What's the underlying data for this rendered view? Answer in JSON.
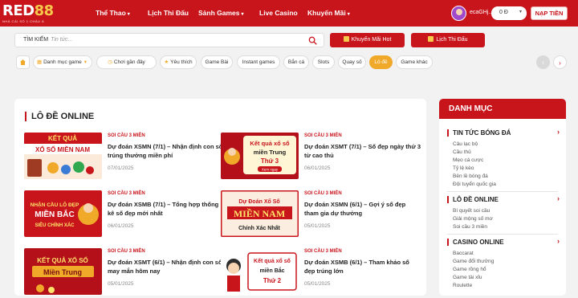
{
  "logo": {
    "brand_main": "RED",
    "brand_num": "88",
    "tagline": "NHÀ CÁI SỐ 1 CHÂU Á"
  },
  "nav": {
    "items": [
      {
        "label": "Thể Thao",
        "caret": "▾"
      },
      {
        "label": "Lịch Thi Đấu",
        "caret": ""
      },
      {
        "label": "Sảnh Games",
        "caret": "▾"
      },
      {
        "label": "Live Casino",
        "caret": ""
      },
      {
        "label": "Khuyến Mãi",
        "caret": "▾"
      }
    ]
  },
  "user": {
    "name": "ecaGHj...",
    "balance": "0 Đ",
    "deposit_label": "NẠP TIỀN"
  },
  "search": {
    "label": "TÌM KIẾM",
    "placeholder": "Tin tức..."
  },
  "hero_buttons": {
    "promo": "Khuyến Mãi Hot",
    "schedule": "Lịch Thi Đấu"
  },
  "filters": [
    {
      "label": "Danh mục game",
      "icon": "grid-icon",
      "active": false
    },
    {
      "label": "Chơi gần đây",
      "icon": "clock-icon",
      "active": false
    },
    {
      "label": "Yêu thích",
      "icon": "star-icon",
      "active": false
    },
    {
      "label": "Game Bài",
      "active": false
    },
    {
      "label": "Instant games",
      "active": false
    },
    {
      "label": "Bắn cá",
      "active": false
    },
    {
      "label": "Slots",
      "active": false
    },
    {
      "label": "Quay số",
      "active": false
    },
    {
      "label": "Lô đề",
      "active": true
    },
    {
      "label": "Game khác",
      "active": false
    }
  ],
  "colors": {
    "brand_red": "#c8141b",
    "accent_orange": "#f0a929"
  },
  "main": {
    "title": "LÔ ĐỀ ONLINE",
    "articles": [
      {
        "category": "SOI CẦU 3 MIỀN",
        "title": "Dự đoán XSMN (7/1) – Nhận định con số trúng thưởng miền phí",
        "date": "07/01/2025",
        "thumb_line1": "KẾT QUẢ",
        "thumb_line2": "XỔ SỐ MIỀN NAM"
      },
      {
        "category": "SOI CẦU 3 MIỀN",
        "title": "Dự đoán XSMT (7/1) – Số đẹp ngày thứ 3 từ cao thủ",
        "date": "06/01/2025",
        "thumb_line1": "Kết quả xổ số",
        "thumb_line2": "miền Trung",
        "thumb_line3": "Thứ 3",
        "thumb_line4": "Xem ngay"
      },
      {
        "category": "SOI CẦU 3 MIỀN",
        "title": "Dự đoán XSMB (7/1) – Tổng hợp thống kê số đẹp mới nhất",
        "date": "06/01/2025",
        "thumb_line1": "NHẬN CẦU LÔ ĐẸP",
        "thumb_line2": "MIỀN BẮC",
        "thumb_line3": "SIÊU CHÍNH XÁC"
      },
      {
        "category": "SOI CẦU 3 MIỀN",
        "title": "Dự đoán XSMN (6/1) – Gợi ý số đẹp tham gia dự thưởng",
        "date": "05/01/2025",
        "thumb_line1": "Dự Đoán Xổ Số",
        "thumb_line2": "MIỀN NAM",
        "thumb_line3": "Chính Xác Nhất"
      },
      {
        "category": "SOI CẦU 3 MIỀN",
        "title": "Dự đoán XSMT (6/1) – Nhận định con số may mắn hôm nay",
        "date": "05/01/2025",
        "thumb_line1": "KẾT QUẢ XỔ SỐ",
        "thumb_line2": "Miền Trung"
      },
      {
        "category": "SOI CẦU 3 MIỀN",
        "title": "Dự đoán XSMB (6/1) – Tham khảo số đẹp trúng lớn",
        "date": "05/01/2025",
        "thumb_line1": "Kết quả xổ số",
        "thumb_line2": "miền Bắc",
        "thumb_line3": "Thứ 2"
      }
    ]
  },
  "sidebar": {
    "title": "DANH MỤC",
    "sections": [
      {
        "title": "TIN TỨC BÓNG ĐÁ",
        "links": [
          "Câu lạc bộ",
          "Cầu thủ",
          "Mẹo cá cược",
          "Tỷ lệ kèo",
          "Bên lề bóng đá",
          "Đội tuyển quốc gia"
        ]
      },
      {
        "title": "LÔ ĐỀ ONLINE",
        "links": [
          "Bí quyết soi cầu",
          "Giải mộng số mơ",
          "Soi cầu 3 miền"
        ]
      },
      {
        "title": "CASINO ONLINE",
        "links": [
          "Baccarat",
          "Game đổi thưởng",
          "Game rồng hổ",
          "Game tài xỉu",
          "Roulette"
        ]
      }
    ]
  }
}
